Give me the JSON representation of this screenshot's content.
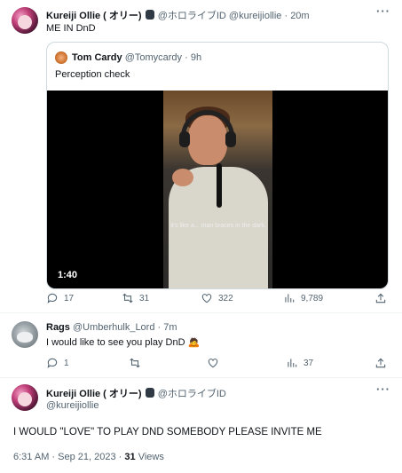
{
  "tweet1": {
    "name": "Kureiji Ollie ( オリー)",
    "handle": "@ホロライブID @kureijiollie",
    "sep": "·",
    "time": "20m",
    "text": "ME IN DnD",
    "quote": {
      "name": "Tom Cardy",
      "handle": "@Tomycardy",
      "sep": "·",
      "time": "9h",
      "text": "Perception check",
      "video_time": "1:40",
      "video_caption": "it's like a... man braces in the dark."
    },
    "actions": {
      "reply": "17",
      "retweet": "31",
      "like": "322",
      "views": "9,789"
    }
  },
  "tweet2": {
    "name": "Rags",
    "handle": "@Umberhulk_Lord",
    "sep": "·",
    "time": "7m",
    "text": "I would like to see you play DnD 🙇",
    "actions": {
      "reply": "1",
      "views": "37"
    }
  },
  "tweet3": {
    "name": "Kureiji Ollie ( オリー)",
    "handle": "@ホロライブID",
    "handle2": "@kureijiollie",
    "text": "I WOULD \"LOVE\" TO PLAY DND SOMEBODY PLEASE INVITE ME",
    "date": "6:31 AM · Sep 21, 2023 ·",
    "views_count": "31",
    "views_label": "Views"
  },
  "colors": {
    "text": "#0f1419",
    "muted": "#536471",
    "border": "#cfd9de"
  }
}
